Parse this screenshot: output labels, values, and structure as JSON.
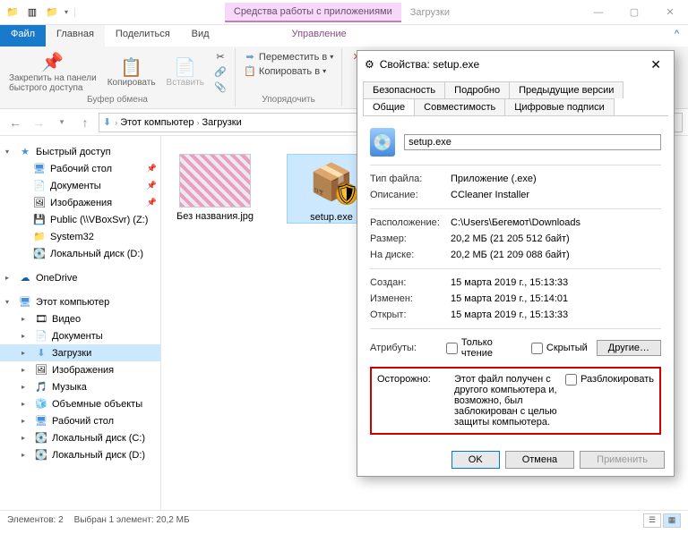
{
  "titlebar": {
    "contextual": "Средства работы с приложениями",
    "title": "Загрузки",
    "min": "—",
    "max": "▢",
    "close": "✕"
  },
  "tabs": {
    "file": "Файл",
    "home": "Главная",
    "share": "Поделиться",
    "view": "Вид",
    "manage": "Управление"
  },
  "ribbon": {
    "pin": "Закрепить на панели\nбыстрого доступа",
    "copy": "Копировать",
    "paste": "Вставить",
    "clipboard": "Буфер обмена",
    "moveto": "Переместить в",
    "copyto": "Копировать в",
    "delete": "Уд",
    "organize": "Упорядочить"
  },
  "breadcrumbs": {
    "root": "Этот компьютер",
    "folder": "Загрузки"
  },
  "sidebar": {
    "quick": "Быстрый доступ",
    "desktop": "Рабочий стол",
    "documents": "Документы",
    "pictures": "Изображения",
    "public": "Public (\\\\VBoxSvr) (Z:)",
    "system32": "System32",
    "localD": "Локальный диск (D:)",
    "onedrive": "OneDrive",
    "thispc": "Этот компьютер",
    "videos": "Видео",
    "docs2": "Документы",
    "downloads": "Загрузки",
    "pics2": "Изображения",
    "music": "Музыка",
    "objects": "Объемные объекты",
    "desk2": "Рабочий стол",
    "diskC": "Локальный диск (C:)",
    "diskD": "Локальный диск (D:)"
  },
  "files": {
    "f1": "Без названия.jpg",
    "f2": "setup.exe"
  },
  "statusbar": {
    "count": "Элементов: 2",
    "sel": "Выбран 1 элемент: 20,2 МБ"
  },
  "dialog": {
    "title": "Свойства: setup.exe",
    "tabs": {
      "security": "Безопасность",
      "details": "Подробно",
      "prev": "Предыдущие версии",
      "general": "Общие",
      "compat": "Совместимость",
      "sig": "Цифровые подписи"
    },
    "filename": "setup.exe",
    "rows": {
      "type_l": "Тип файла:",
      "type_v": "Приложение (.exe)",
      "desc_l": "Описание:",
      "desc_v": "CCleaner Installer",
      "loc_l": "Расположение:",
      "loc_v": "C:\\Users\\Бегемот\\Downloads",
      "size_l": "Размер:",
      "size_v": "20,2 МБ (21 205 512 байт)",
      "disk_l": "На диске:",
      "disk_v": "20,2 МБ (21 209 088 байт)",
      "created_l": "Создан:",
      "created_v": "15 марта 2019 г., 15:13:33",
      "modified_l": "Изменен:",
      "modified_v": "15 марта 2019 г., 15:14:01",
      "opened_l": "Открыт:",
      "opened_v": "15 марта 2019 г., 15:13:33",
      "attr_l": "Атрибуты:"
    },
    "readonly": "Только чтение",
    "hidden": "Скрытый",
    "other": "Другие…",
    "warn_l": "Осторожно:",
    "warn_t": "Этот файл получен с другого компьютера и, возможно, был заблокирован с целью защиты компьютера.",
    "unblock": "Разблокировать",
    "ok": "OK",
    "cancel": "Отмена",
    "apply": "Применить"
  }
}
